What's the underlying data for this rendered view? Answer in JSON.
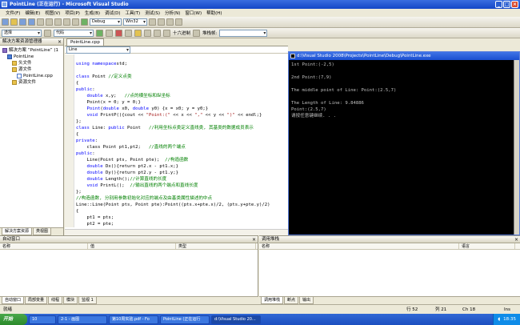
{
  "window": {
    "title": "PointLine (正在运行) - Microsoft Visual Studio"
  },
  "menu": [
    "文件(F)",
    "编辑(E)",
    "视图(V)",
    "项目(P)",
    "生成(B)",
    "调试(D)",
    "工具(T)",
    "测试(S)",
    "分析(N)",
    "窗口(W)",
    "帮助(H)"
  ],
  "toolbar": {
    "config": "Debug",
    "platform": "Win32",
    "hex_label": "十六进制",
    "row2_combo1": "选择",
    "row2_combo2": "代码",
    "row2_label": "堆栈帧:"
  },
  "solution_explorer": {
    "title": "解决方案资源管理器",
    "items": [
      {
        "label": "解决方案 “PointLine” (1",
        "kind": "sol",
        "indent": 0
      },
      {
        "label": "PointLine",
        "kind": "proj",
        "indent": 1
      },
      {
        "label": "头文件",
        "kind": "folder",
        "indent": 2
      },
      {
        "label": "源文件",
        "kind": "folder",
        "indent": 2
      },
      {
        "label": "PointLine.cpp",
        "kind": "cpp",
        "indent": 3
      },
      {
        "label": "资源文件",
        "kind": "folder",
        "indent": 2
      }
    ],
    "tabs": [
      "解决方案资源",
      "类视图"
    ]
  },
  "editor": {
    "tab": "PointLine.cpp",
    "nav": "Line",
    "lines": [
      [
        [
          "",
          ""
        ]
      ],
      [
        [
          "kw",
          "using namespace"
        ],
        [
          "",
          "std;"
        ]
      ],
      [
        [
          "",
          ""
        ]
      ],
      [
        [
          "kw",
          "class"
        ],
        [
          "",
          " Point "
        ],
        [
          "cm",
          "//定义点类"
        ]
      ],
      [
        [
          "",
          "{"
        ]
      ],
      [
        [
          "kw",
          "public"
        ],
        [
          "",
          ":"
        ]
      ],
      [
        [
          "kw",
          "    double"
        ],
        [
          "",
          " x,y;   "
        ],
        [
          "cm",
          "//点的横坐标和纵坐标"
        ]
      ],
      [
        [
          "",
          "    Point(x = 0; y = 0;}"
        ]
      ],
      [
        [
          "kw",
          "    Point"
        ],
        [
          "",
          "("
        ],
        [
          "kw",
          "double"
        ],
        [
          "",
          " x0, "
        ],
        [
          "kw",
          "double"
        ],
        [
          "",
          " y0) {x = x0; y = y0;}"
        ]
      ],
      [
        [
          "kw",
          "    void"
        ],
        [
          "",
          " PrintP(){cout << "
        ],
        [
          "st",
          "\"Point:(\""
        ],
        [
          "",
          " << x << "
        ],
        [
          "st",
          "\",\""
        ],
        [
          "",
          " << y << "
        ],
        [
          "st",
          "\")\""
        ],
        [
          "",
          " << endl;}"
        ]
      ],
      [
        [
          "",
          "};"
        ]
      ],
      [
        [
          "kw",
          "class"
        ],
        [
          "",
          " Line: "
        ],
        [
          "kw",
          "public"
        ],
        [
          "",
          " Point   "
        ],
        [
          "cm",
          "//利用坐标点类定义直线类, 其基类的数据成员表示"
        ]
      ],
      [
        [
          "",
          "{"
        ]
      ],
      [
        [
          "kw",
          "private"
        ],
        [
          "",
          ":"
        ]
      ],
      [
        [
          "",
          ""
        ],
        [
          "",
          "    class Point pt1,pt2;   "
        ],
        [
          "cm",
          "//直线的两个端点"
        ]
      ],
      [
        [
          "kw",
          "public"
        ],
        [
          "",
          ":"
        ]
      ],
      [
        [
          "",
          "    Line(Point pts, Point pte);  "
        ],
        [
          "cm",
          "//构造函数"
        ]
      ],
      [
        [
          "kw",
          "    double"
        ],
        [
          "",
          " Dx(){return pt2.x - pt1.x;}"
        ]
      ],
      [
        [
          "kw",
          "    double"
        ],
        [
          "",
          " Dy(){return pt2.y - pt1.y;}"
        ]
      ],
      [
        [
          "kw",
          "    double"
        ],
        [
          "",
          " Length();"
        ],
        [
          "cm",
          "//计算直线的长度"
        ]
      ],
      [
        [
          "kw",
          "    void"
        ],
        [
          "",
          " PrintL();  "
        ],
        [
          "cm",
          "//输出直线的两个端点和直线长度"
        ]
      ],
      [
        [
          "",
          "};"
        ]
      ],
      [
        [
          "cm",
          "//构造函数, 分别用参数初始化对应的端点及由基类属性描述的中点"
        ]
      ],
      [
        [
          "",
          "Line::Line(Point pts, Point pte):Point((pts.x+pte.x)/2, (pts.y+pte.y)/2)"
        ]
      ],
      [
        [
          "",
          "{"
        ]
      ],
      [
        [
          "",
          "    pt1 = pts;"
        ]
      ],
      [
        [
          "",
          "    pt2 = pte;"
        ]
      ]
    ]
  },
  "console": {
    "title": "d:\\Visual Studio 2008\\Projects\\PointLine\\Debug\\PointLine.exe",
    "lines": [
      "1st Point:(-2,5)",
      "",
      "2nd Point:(7,9)",
      "",
      "The middle point of Line: Point:(2.5,7)",
      "",
      "The Length of Line: 9.84886",
      "Point:(2.5,7)",
      "请按任意键继续. . ."
    ]
  },
  "autos": {
    "title": "自动窗口",
    "col1": "名称",
    "col2": "值",
    "col3": "类型",
    "tabs": [
      "自动窗口",
      "局部变量",
      "线程",
      "模块",
      "监视 1"
    ]
  },
  "callstack": {
    "title": "调用堆栈",
    "col1": "名称",
    "col2": "语言",
    "tabs": [
      "调用堆栈",
      "断点",
      "输出"
    ]
  },
  "status": {
    "ready": "就绪",
    "line": "行 52",
    "col": "列 21",
    "ch": "Ch 18",
    "mode": "Ins"
  },
  "taskbar": {
    "start": "开始",
    "items": [
      "10",
      "2-1 - 画图",
      "第10周实验.pdf - Fo",
      "PointLine (正在运行",
      "d:\\Visual Studio 20..."
    ],
    "clock": "18:35"
  }
}
